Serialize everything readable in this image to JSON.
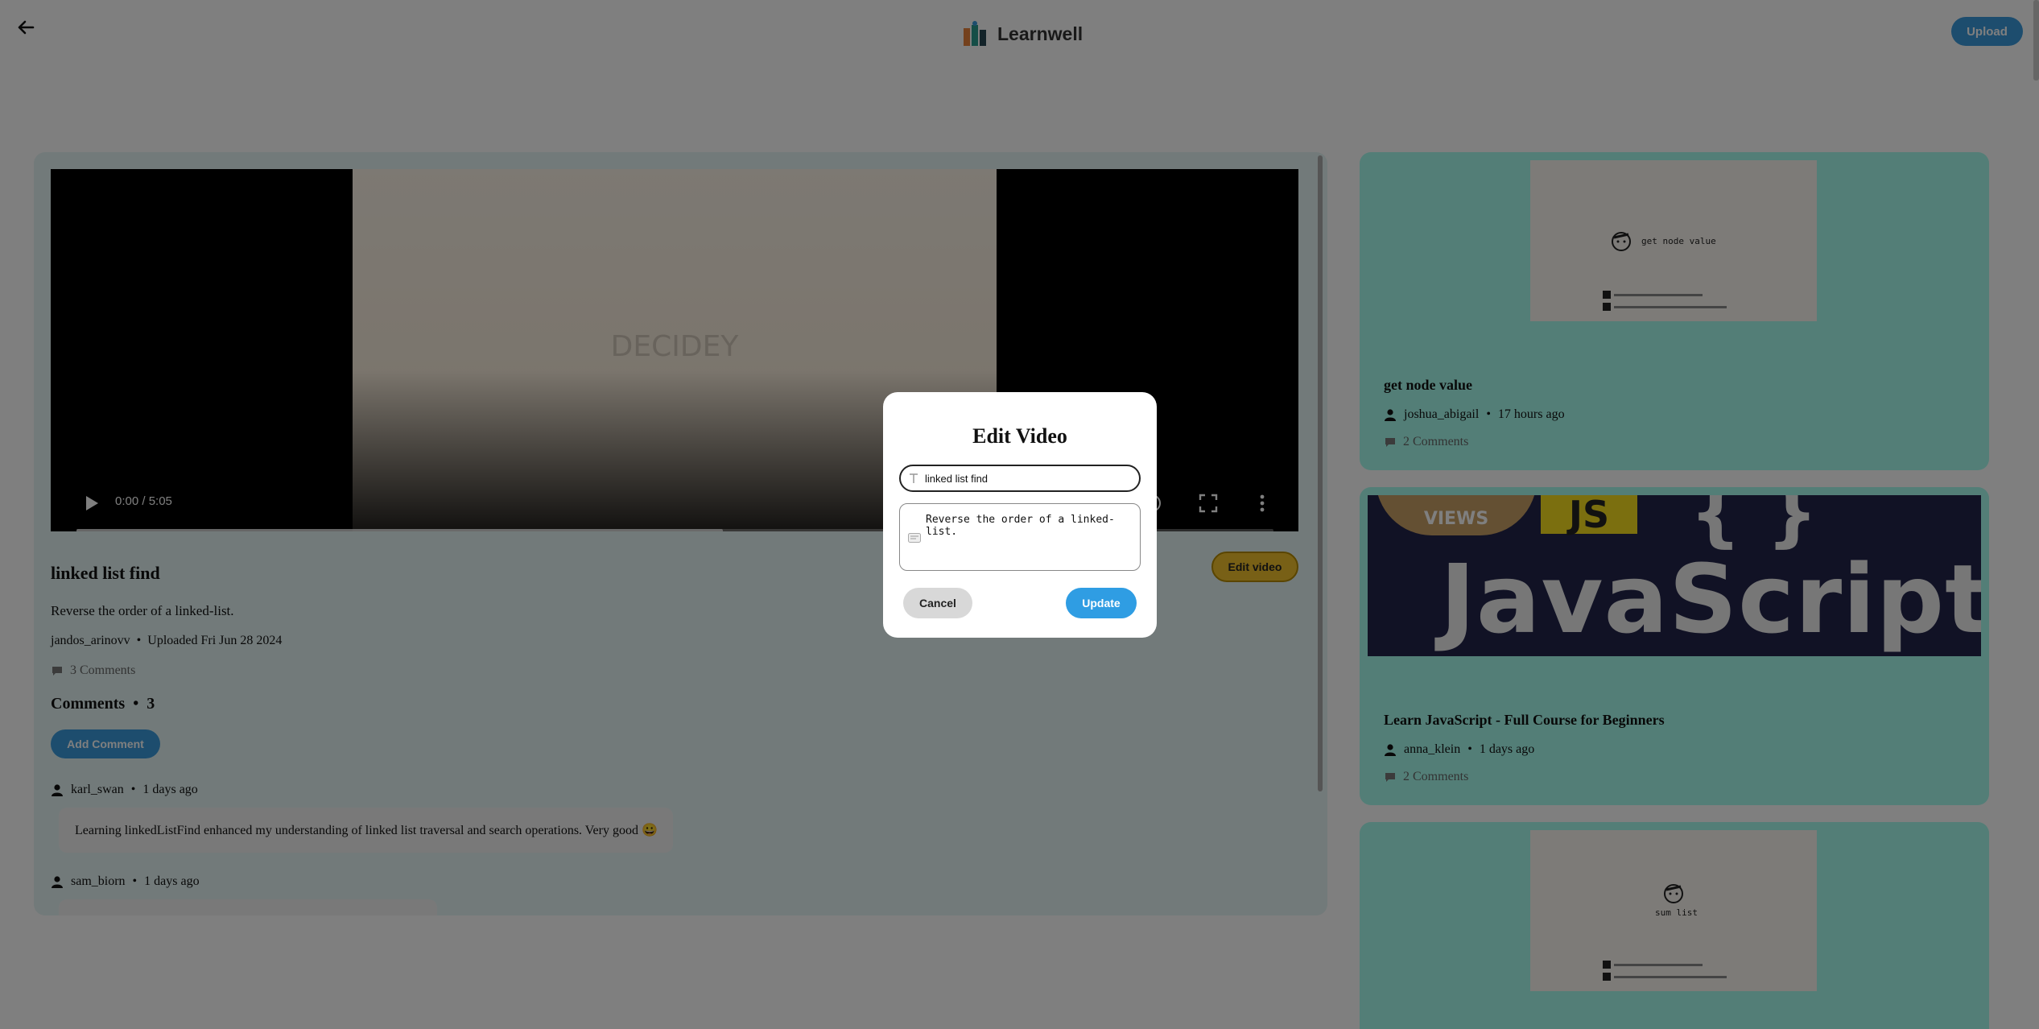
{
  "header": {
    "brand_name": "Learnwell",
    "upload_label": "Upload"
  },
  "video": {
    "time": "0:00 / 5:05",
    "progress_buffered_fraction": 0.54,
    "frame_watermark": "DECIDEY",
    "title": "linked list find",
    "description": "Reverse the order of a linked-list.",
    "uploader": "jandos_arinovv",
    "bullet": "•",
    "uploaded": "Uploaded Fri Jun 28 2024",
    "comments_summary": "3 Comments",
    "edit_label": "Edit video"
  },
  "comments": {
    "heading": "Comments",
    "count": "3",
    "add_label": "Add Comment",
    "items": [
      {
        "user": "karl_swan",
        "time": "1 days ago",
        "text": "Learning linkedListFind enhanced my understanding of linked list traversal and search operations. Very good 😀"
      },
      {
        "user": "sam_biorn",
        "time": "1 days ago",
        "text": ""
      }
    ]
  },
  "sidebar": {
    "cards": [
      {
        "thumb_caption": "get node value",
        "title": "get node value",
        "user": "joshua_abigail",
        "time": "17 hours ago",
        "comments": "2 Comments"
      },
      {
        "thumb_views": "VIEWS",
        "thumb_badge": "JS",
        "thumb_text": "JavaScript",
        "thumb_paren": "{ }",
        "title": "Learn JavaScript - Full Course for Beginners",
        "user": "anna_klein",
        "time": "1 days ago",
        "comments": "2 Comments"
      },
      {
        "thumb_caption": "sum list"
      }
    ]
  },
  "modal": {
    "title": "Edit Video",
    "title_value": "linked list find",
    "description_value": "Reverse the order of a linked-list.",
    "cancel_label": "Cancel",
    "update_label": "Update"
  },
  "colors": {
    "accent_blue": "#3a9bdc",
    "edit_yellow": "#f0c12c",
    "card_teal": "#a6fcee",
    "panel_bg": "#e4f5f5",
    "overlay": "rgba(0,0,0,0.5)"
  },
  "icons": [
    "arrow-left-icon",
    "learnwell-logo-icon",
    "play-icon",
    "volume-icon",
    "fullscreen-icon",
    "more-vertical-icon",
    "comment-icon",
    "user-icon",
    "text-field-icon",
    "textarea-icon"
  ]
}
